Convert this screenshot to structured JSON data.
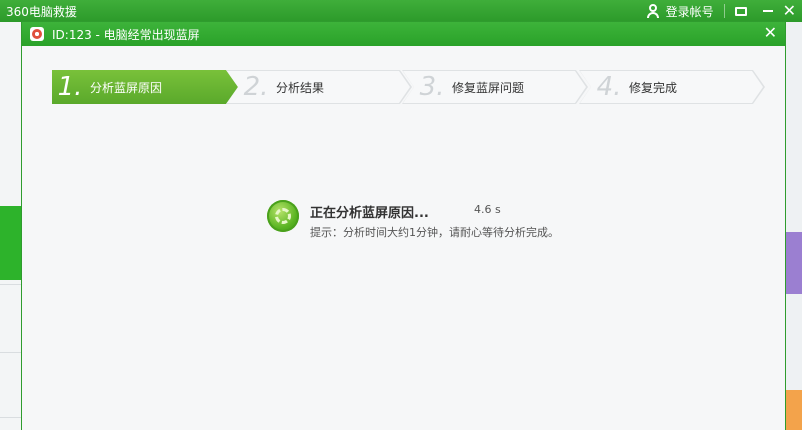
{
  "app": {
    "title": "360电脑救援",
    "login_label": "登录帐号"
  },
  "dialog": {
    "title": "ID:123 - 电脑经常出现蓝屏"
  },
  "steps": [
    {
      "num": "1.",
      "label": "分析蓝屏原因",
      "state": "active"
    },
    {
      "num": "2.",
      "label": "分析结果",
      "state": "inactive"
    },
    {
      "num": "3.",
      "label": "修复蓝屏问题",
      "state": "inactive"
    },
    {
      "num": "4.",
      "label": "修复完成",
      "state": "inactive"
    }
  ],
  "progress": {
    "status": "正在分析蓝屏原因...",
    "elapsed": "4.6 s",
    "tip": "提示：分析时间大约1分钟，请耐心等待分析完成。"
  },
  "colors": {
    "brand_green": "#2db32b",
    "step_active": "#6bb634"
  },
  "icons": [
    "user-icon",
    "message-icon",
    "minimize-icon",
    "close-icon",
    "lifebuoy-icon",
    "spinner-icon"
  ]
}
